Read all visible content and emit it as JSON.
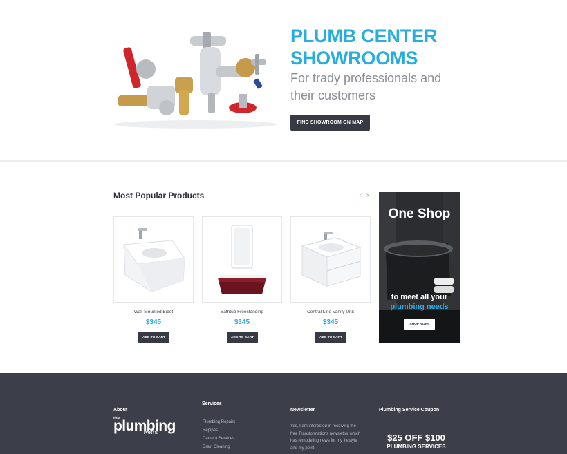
{
  "hero": {
    "title": "PLUMB CENTER SHOWROOMS",
    "subtitle": "For trady professionals and their customers",
    "button_label": "FIND SHOWROOM ON MAP"
  },
  "products": {
    "section_title": "Most Popular Products",
    "prev_icon": "‹",
    "next_icon": "›",
    "items": [
      {
        "name": "Wall-Mounted Bidet",
        "price": "$345",
        "button_label": "ADD TO CART"
      },
      {
        "name": "Bathtub Freestanding",
        "price": "$345",
        "button_label": "ADD TO CART"
      },
      {
        "name": "Central Line Vanity Unit",
        "price": "$345",
        "button_label": "ADD TO CART"
      }
    ]
  },
  "banner": {
    "title": "One Shop",
    "line1": "to meet all your",
    "line2": "plumbing needs",
    "button_label": "SHOP NOW!"
  },
  "footer": {
    "about": {
      "heading": "About",
      "logo_the": "the",
      "logo_main": "plumbing",
      "logo_parts": "PARTS"
    },
    "services": {
      "heading": "Services",
      "items": [
        "Plumbing Repairs",
        "Repipes",
        "Camera Services",
        "Drain Cleaning"
      ]
    },
    "newsletter": {
      "heading": "Newsletter",
      "text": "Yes, I am interested in receiving the free Transformations newsletter which has remodeling news for my lifestyle and my point"
    },
    "coupon": {
      "heading": "Plumbing Service Coupon",
      "big": "$25 OFF $100",
      "small": "PLUMBING SERVICES"
    }
  },
  "colors": {
    "accent": "#26aee0",
    "button_dark": "#373a42",
    "footer_bg": "#3c3f4a",
    "subtitle_gray": "#8c8e96"
  }
}
